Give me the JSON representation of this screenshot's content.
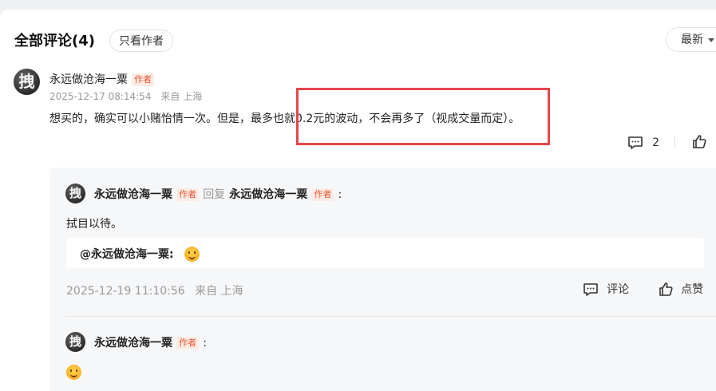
{
  "header": {
    "title": "全部评论(4)",
    "filter_button": "只看作者",
    "sort_label": "最新"
  },
  "comment": {
    "avatar_glyph": "拽",
    "author": "永远做沧海一粟",
    "author_badge": "作者",
    "time": "2025-12-17 08:14:54",
    "location": "来自 上海",
    "text": "想买的，确实可以小赌怡情一次。但是，最多也就0.2元的波动，不会再多了（视成交量而定）。",
    "reply_count": "2",
    "highlight_color": "#e5454c"
  },
  "replies": [
    {
      "avatar_glyph": "拽",
      "author": "永远做沧海一粟",
      "author_badge": "作者",
      "reply_word": "回复",
      "target": "永远做沧海一粟",
      "target_badge": "作者",
      "colon": ":",
      "text": "拭目以待。",
      "quote_author": "@永远做沧海一粟:",
      "time": "2025-12-19 11:10:56",
      "location": "来自 上海",
      "comment_label": "评论",
      "like_label": "点赞"
    },
    {
      "avatar_glyph": "拽",
      "author": "永远做沧海一粟",
      "author_badge": "作者",
      "colon": ":"
    }
  ],
  "icons": [
    "comment-icon",
    "thumbs-up-icon",
    "smile-emoji-icon"
  ],
  "colors": {
    "badge_text": "#e4572e",
    "badge_bg": "#fdebe5",
    "meta": "#999999"
  }
}
